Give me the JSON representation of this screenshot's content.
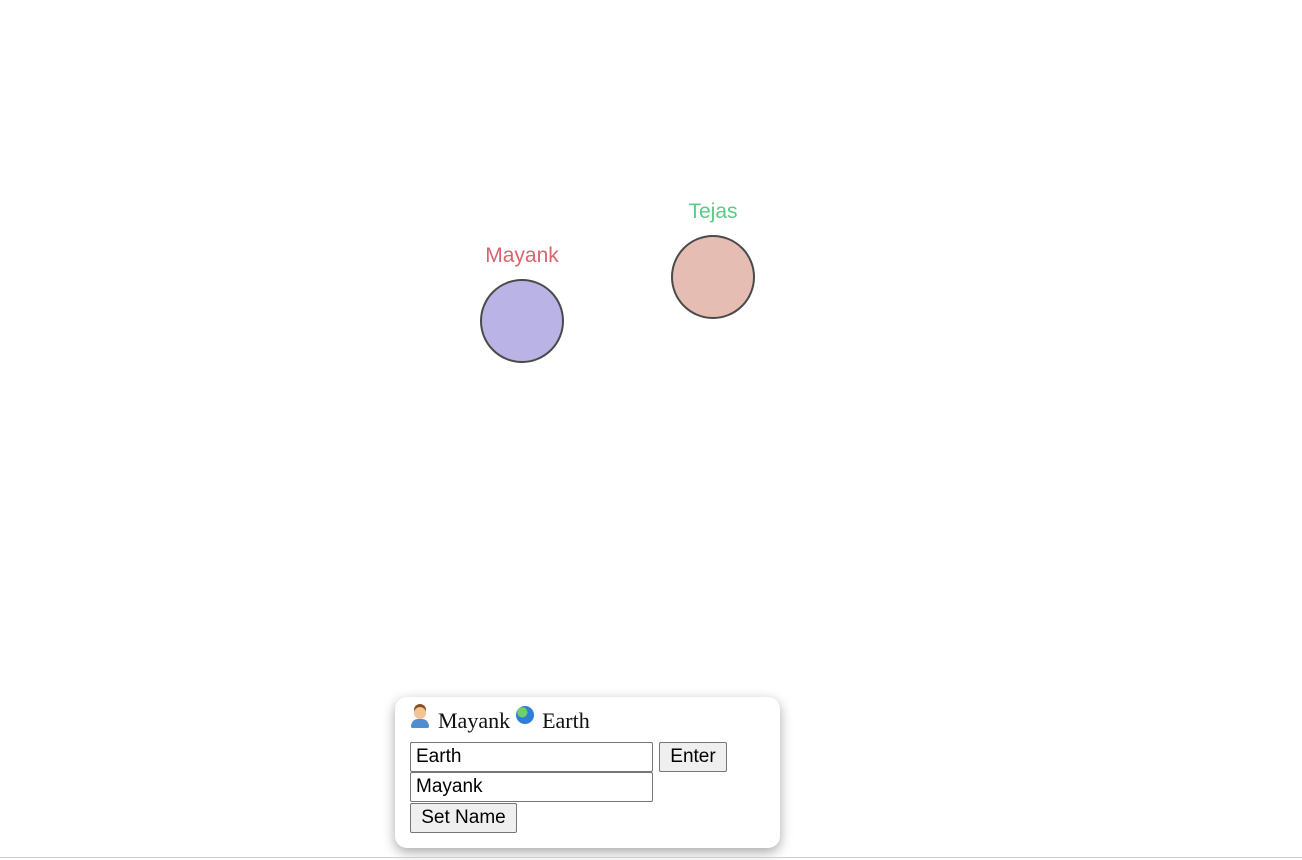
{
  "avatars": [
    {
      "name": "Mayank",
      "label_color": "#d9646e",
      "fill_color": "#bab3e5"
    },
    {
      "name": "Tejas",
      "label_color": "#5acb85",
      "fill_color": "#e5bdb3"
    }
  ],
  "panel": {
    "user_icon": "person-emoji",
    "user_name": "Mayank",
    "room_icon": "globe-emoji",
    "room_name": "Earth",
    "room_input_value": "Earth",
    "enter_label": "Enter",
    "name_input_value": "Mayank",
    "set_name_label": "Set Name"
  }
}
